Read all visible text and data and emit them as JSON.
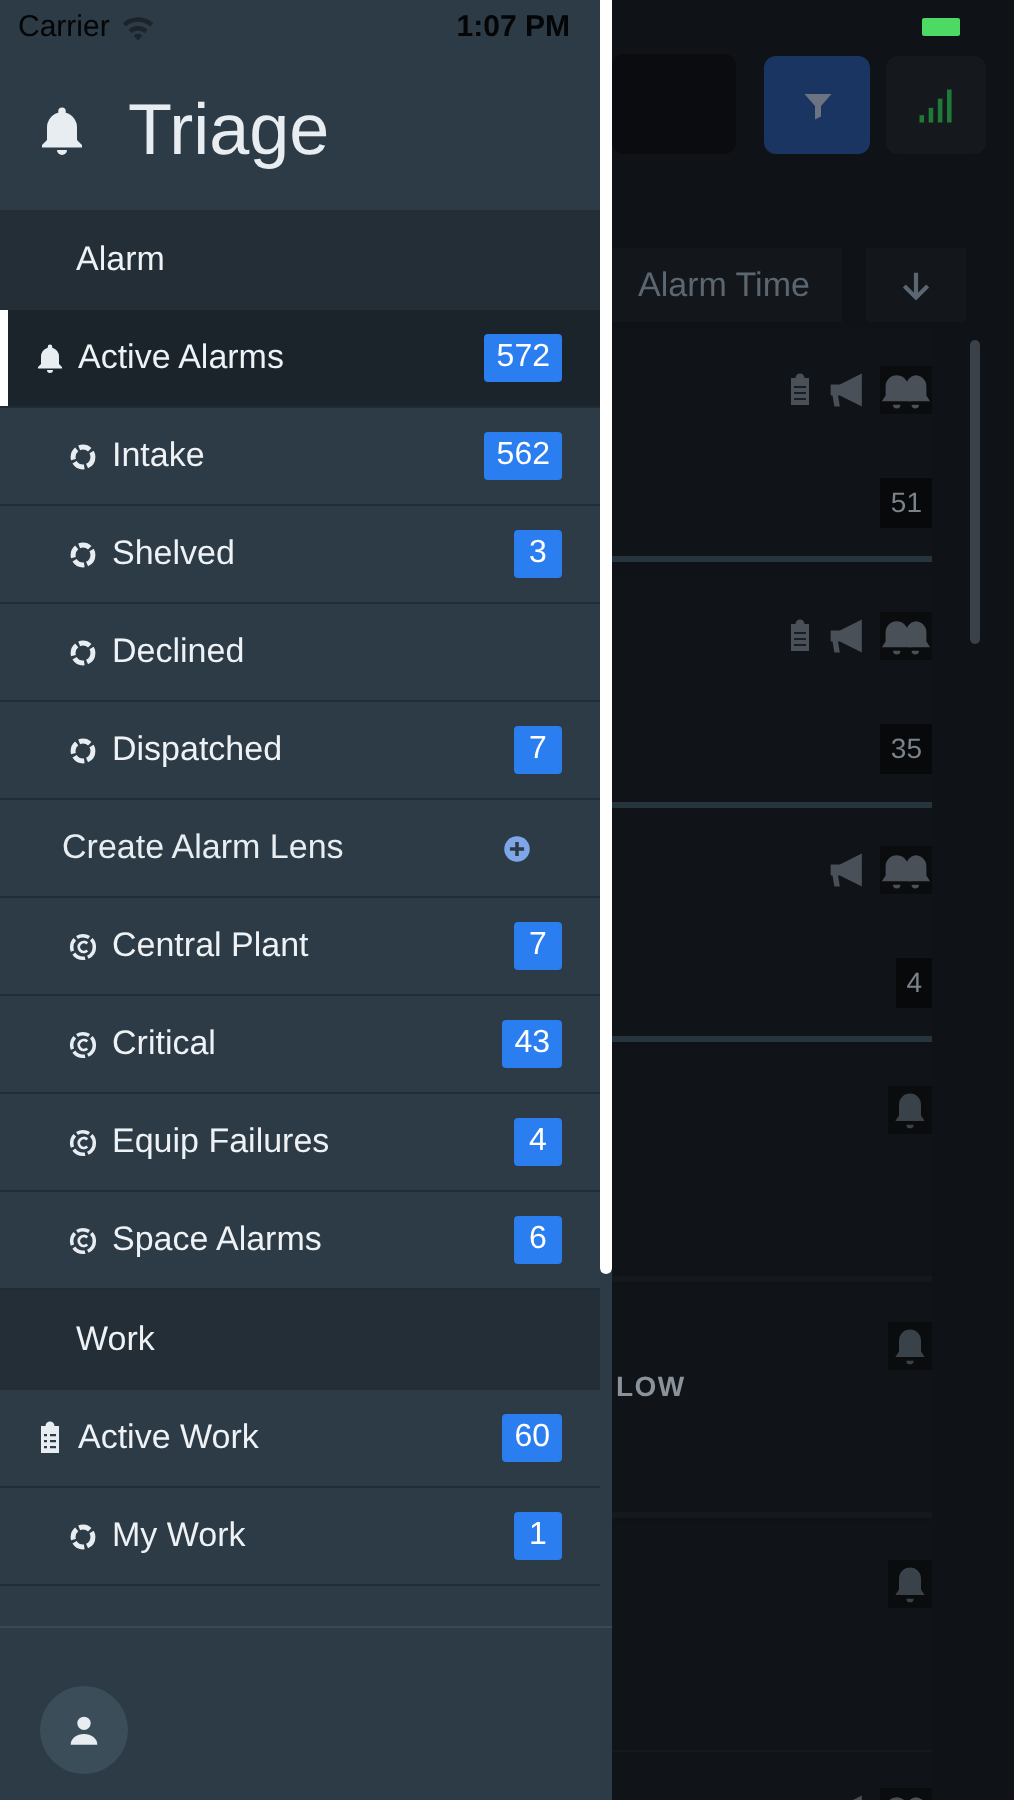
{
  "status_bar": {
    "carrier": "Carrier",
    "time": "1:07 PM"
  },
  "drawer": {
    "title": "Triage",
    "sections": [
      {
        "label": "Alarm",
        "items": [
          {
            "kind": "bell",
            "label": "Active Alarms",
            "count": "572",
            "selected": true,
            "children": [
              {
                "kind": "filter",
                "label": "Intake",
                "count": "562",
                "selected": false
              },
              {
                "kind": "filter",
                "label": "Shelved",
                "count": "3",
                "selected": false
              },
              {
                "kind": "filter",
                "label": "Declined",
                "selected": false
              },
              {
                "kind": "filter",
                "label": "Dispatched",
                "count": "7",
                "selected": false
              },
              {
                "kind": "create",
                "label": "Create Alarm Lens"
              },
              {
                "kind": "lens",
                "label": "Central Plant",
                "count": "7",
                "selected": false
              },
              {
                "kind": "lens",
                "label": "Critical",
                "count": "43",
                "selected": false
              },
              {
                "kind": "lens",
                "label": "Equip Failures",
                "count": "4",
                "selected": false
              },
              {
                "kind": "lens",
                "label": "Space Alarms",
                "count": "6",
                "selected": false
              }
            ]
          }
        ]
      },
      {
        "label": "Work",
        "items": [
          {
            "kind": "clipboard",
            "label": "Active Work",
            "count": "60",
            "selected": false,
            "children": [
              {
                "kind": "filter",
                "label": "My Work",
                "count": "1",
                "selected": false
              }
            ]
          }
        ]
      }
    ]
  },
  "list": {
    "sort_label": "Alarm Time",
    "cards": [
      {
        "work": true,
        "announce": true,
        "multiple": true,
        "count": "51"
      },
      {
        "work": true,
        "announce": true,
        "multiple": true,
        "count": "35"
      },
      {
        "work": false,
        "announce": true,
        "multiple": true,
        "count": "4"
      },
      {
        "work": false,
        "announce": false,
        "multiple": false
      },
      {
        "work": false,
        "announce": false,
        "multiple": false,
        "priority": "LOW"
      },
      {
        "work": false,
        "announce": false,
        "multiple": false
      },
      {
        "work": false,
        "announce": true,
        "multiple": true
      }
    ]
  }
}
